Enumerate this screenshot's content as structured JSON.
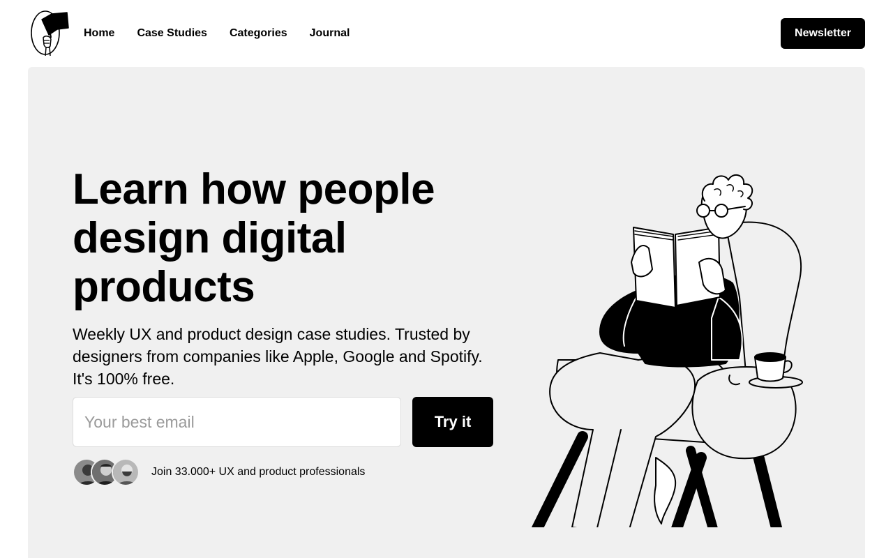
{
  "nav": {
    "logo_icon": "flag-hand-icon",
    "links": [
      {
        "label": "Home"
      },
      {
        "label": "Case Studies"
      },
      {
        "label": "Categories"
      },
      {
        "label": "Journal"
      }
    ],
    "newsletter_label": "Newsletter"
  },
  "hero": {
    "title": "Learn how people design digital products",
    "subtitle": "Weekly UX and product design case studies. Trusted by designers from companies like Apple, Google and Spotify. It's 100% free.",
    "email_placeholder": "Your best email",
    "email_value": "",
    "cta_label": "Try it",
    "social_proof": "Join 33.000+ UX and product professionals",
    "illustration_icon": "person-reading-in-armchair-illustration"
  },
  "colors": {
    "background": "#ffffff",
    "hero_background": "#f0f0f0",
    "button": "#000000",
    "button_text": "#ffffff",
    "placeholder": "#9a9a9a"
  }
}
